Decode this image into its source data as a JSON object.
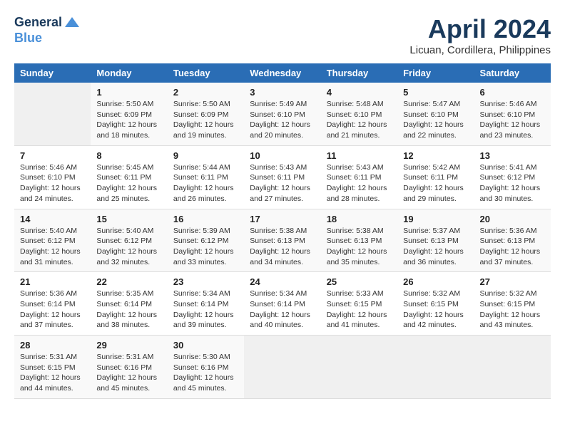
{
  "header": {
    "logo_line1": "General",
    "logo_line2": "Blue",
    "month_title": "April 2024",
    "location": "Licuan, Cordillera, Philippines"
  },
  "days_of_week": [
    "Sunday",
    "Monday",
    "Tuesday",
    "Wednesday",
    "Thursday",
    "Friday",
    "Saturday"
  ],
  "weeks": [
    {
      "days": [
        {
          "num": "",
          "empty": true
        },
        {
          "num": "1",
          "sunrise": "Sunrise: 5:50 AM",
          "sunset": "Sunset: 6:09 PM",
          "daylight": "Daylight: 12 hours and 18 minutes."
        },
        {
          "num": "2",
          "sunrise": "Sunrise: 5:50 AM",
          "sunset": "Sunset: 6:09 PM",
          "daylight": "Daylight: 12 hours and 19 minutes."
        },
        {
          "num": "3",
          "sunrise": "Sunrise: 5:49 AM",
          "sunset": "Sunset: 6:10 PM",
          "daylight": "Daylight: 12 hours and 20 minutes."
        },
        {
          "num": "4",
          "sunrise": "Sunrise: 5:48 AM",
          "sunset": "Sunset: 6:10 PM",
          "daylight": "Daylight: 12 hours and 21 minutes."
        },
        {
          "num": "5",
          "sunrise": "Sunrise: 5:47 AM",
          "sunset": "Sunset: 6:10 PM",
          "daylight": "Daylight: 12 hours and 22 minutes."
        },
        {
          "num": "6",
          "sunrise": "Sunrise: 5:46 AM",
          "sunset": "Sunset: 6:10 PM",
          "daylight": "Daylight: 12 hours and 23 minutes."
        }
      ]
    },
    {
      "days": [
        {
          "num": "7",
          "sunrise": "Sunrise: 5:46 AM",
          "sunset": "Sunset: 6:10 PM",
          "daylight": "Daylight: 12 hours and 24 minutes."
        },
        {
          "num": "8",
          "sunrise": "Sunrise: 5:45 AM",
          "sunset": "Sunset: 6:11 PM",
          "daylight": "Daylight: 12 hours and 25 minutes."
        },
        {
          "num": "9",
          "sunrise": "Sunrise: 5:44 AM",
          "sunset": "Sunset: 6:11 PM",
          "daylight": "Daylight: 12 hours and 26 minutes."
        },
        {
          "num": "10",
          "sunrise": "Sunrise: 5:43 AM",
          "sunset": "Sunset: 6:11 PM",
          "daylight": "Daylight: 12 hours and 27 minutes."
        },
        {
          "num": "11",
          "sunrise": "Sunrise: 5:43 AM",
          "sunset": "Sunset: 6:11 PM",
          "daylight": "Daylight: 12 hours and 28 minutes."
        },
        {
          "num": "12",
          "sunrise": "Sunrise: 5:42 AM",
          "sunset": "Sunset: 6:11 PM",
          "daylight": "Daylight: 12 hours and 29 minutes."
        },
        {
          "num": "13",
          "sunrise": "Sunrise: 5:41 AM",
          "sunset": "Sunset: 6:12 PM",
          "daylight": "Daylight: 12 hours and 30 minutes."
        }
      ]
    },
    {
      "days": [
        {
          "num": "14",
          "sunrise": "Sunrise: 5:40 AM",
          "sunset": "Sunset: 6:12 PM",
          "daylight": "Daylight: 12 hours and 31 minutes."
        },
        {
          "num": "15",
          "sunrise": "Sunrise: 5:40 AM",
          "sunset": "Sunset: 6:12 PM",
          "daylight": "Daylight: 12 hours and 32 minutes."
        },
        {
          "num": "16",
          "sunrise": "Sunrise: 5:39 AM",
          "sunset": "Sunset: 6:12 PM",
          "daylight": "Daylight: 12 hours and 33 minutes."
        },
        {
          "num": "17",
          "sunrise": "Sunrise: 5:38 AM",
          "sunset": "Sunset: 6:13 PM",
          "daylight": "Daylight: 12 hours and 34 minutes."
        },
        {
          "num": "18",
          "sunrise": "Sunrise: 5:38 AM",
          "sunset": "Sunset: 6:13 PM",
          "daylight": "Daylight: 12 hours and 35 minutes."
        },
        {
          "num": "19",
          "sunrise": "Sunrise: 5:37 AM",
          "sunset": "Sunset: 6:13 PM",
          "daylight": "Daylight: 12 hours and 36 minutes."
        },
        {
          "num": "20",
          "sunrise": "Sunrise: 5:36 AM",
          "sunset": "Sunset: 6:13 PM",
          "daylight": "Daylight: 12 hours and 37 minutes."
        }
      ]
    },
    {
      "days": [
        {
          "num": "21",
          "sunrise": "Sunrise: 5:36 AM",
          "sunset": "Sunset: 6:14 PM",
          "daylight": "Daylight: 12 hours and 37 minutes."
        },
        {
          "num": "22",
          "sunrise": "Sunrise: 5:35 AM",
          "sunset": "Sunset: 6:14 PM",
          "daylight": "Daylight: 12 hours and 38 minutes."
        },
        {
          "num": "23",
          "sunrise": "Sunrise: 5:34 AM",
          "sunset": "Sunset: 6:14 PM",
          "daylight": "Daylight: 12 hours and 39 minutes."
        },
        {
          "num": "24",
          "sunrise": "Sunrise: 5:34 AM",
          "sunset": "Sunset: 6:14 PM",
          "daylight": "Daylight: 12 hours and 40 minutes."
        },
        {
          "num": "25",
          "sunrise": "Sunrise: 5:33 AM",
          "sunset": "Sunset: 6:15 PM",
          "daylight": "Daylight: 12 hours and 41 minutes."
        },
        {
          "num": "26",
          "sunrise": "Sunrise: 5:32 AM",
          "sunset": "Sunset: 6:15 PM",
          "daylight": "Daylight: 12 hours and 42 minutes."
        },
        {
          "num": "27",
          "sunrise": "Sunrise: 5:32 AM",
          "sunset": "Sunset: 6:15 PM",
          "daylight": "Daylight: 12 hours and 43 minutes."
        }
      ]
    },
    {
      "days": [
        {
          "num": "28",
          "sunrise": "Sunrise: 5:31 AM",
          "sunset": "Sunset: 6:15 PM",
          "daylight": "Daylight: 12 hours and 44 minutes."
        },
        {
          "num": "29",
          "sunrise": "Sunrise: 5:31 AM",
          "sunset": "Sunset: 6:16 PM",
          "daylight": "Daylight: 12 hours and 45 minutes."
        },
        {
          "num": "30",
          "sunrise": "Sunrise: 5:30 AM",
          "sunset": "Sunset: 6:16 PM",
          "daylight": "Daylight: 12 hours and 45 minutes."
        },
        {
          "num": "",
          "empty": true
        },
        {
          "num": "",
          "empty": true
        },
        {
          "num": "",
          "empty": true
        },
        {
          "num": "",
          "empty": true
        }
      ]
    }
  ]
}
